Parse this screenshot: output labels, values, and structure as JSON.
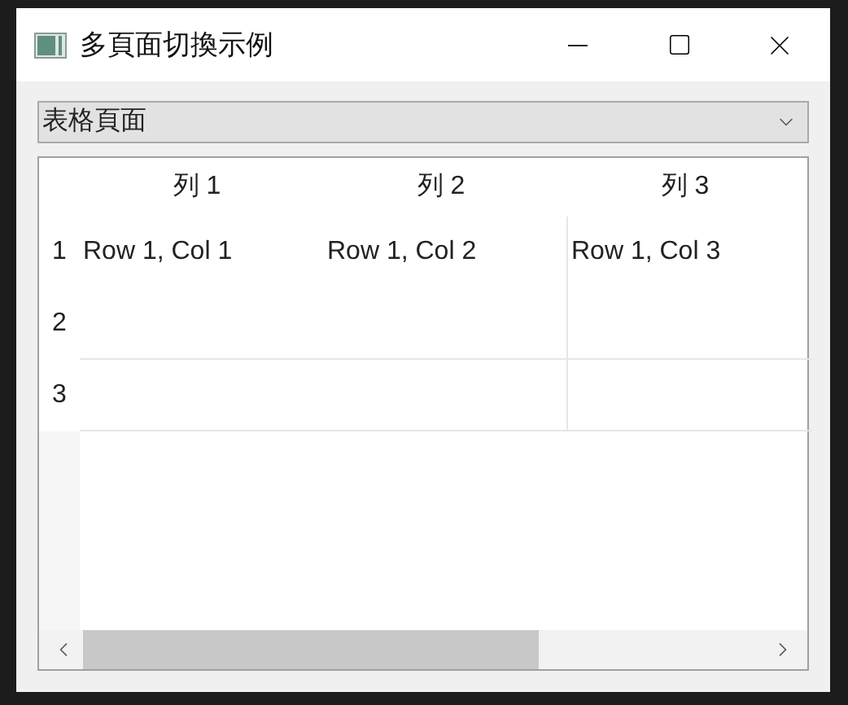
{
  "window": {
    "title": "多頁面切換示例"
  },
  "page_selector": {
    "value": "表格頁面"
  },
  "table": {
    "columns": [
      "列 1",
      "列 2",
      "列 3"
    ],
    "rows": [
      {
        "header": "1",
        "cells": [
          "Row 1, Col 1",
          "Row 1, Col 2",
          "Row 1, Col 3"
        ]
      },
      {
        "header": "2"
      },
      {
        "header": "3"
      }
    ]
  }
}
